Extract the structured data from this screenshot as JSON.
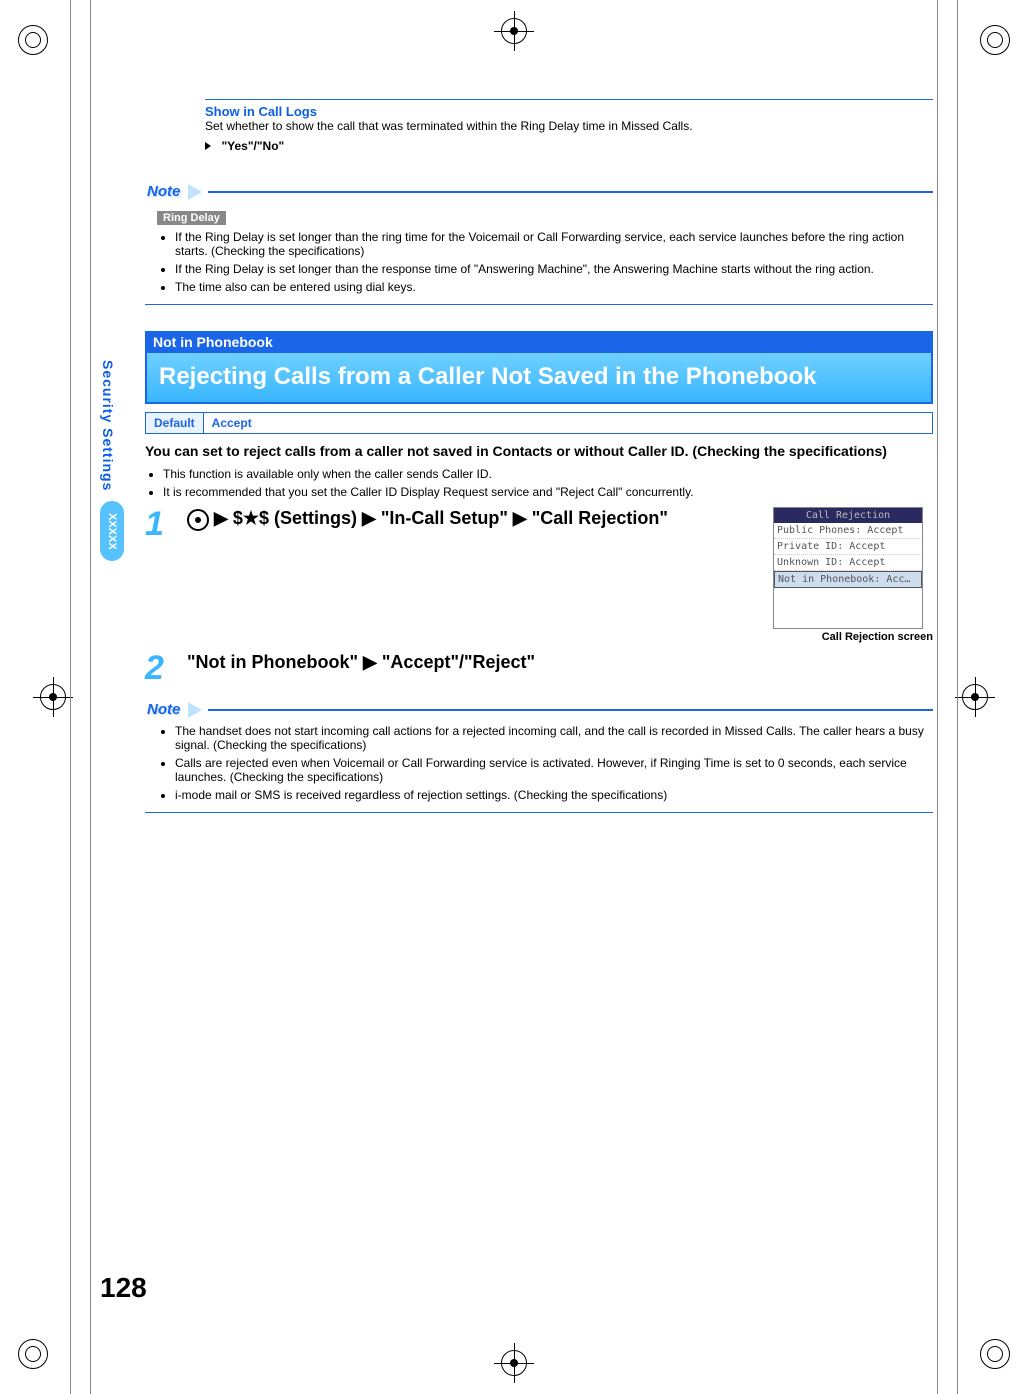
{
  "side": {
    "label": "Security Settings",
    "block": "XXXXX"
  },
  "show_in_call_logs": {
    "heading": "Show in Call Logs",
    "desc": "Set whether to show the call that was terminated within the Ring Delay time in Missed Calls.",
    "option": "\"Yes\"/\"No\""
  },
  "note1": {
    "label": "Note",
    "chip": "Ring Delay",
    "bullets": [
      "If the Ring Delay is set longer than the ring time for the Voicemail or Call Forwarding service, each service launches before the ring action starts. (Checking the specifications)",
      "If the Ring Delay is set longer than the response time of \"Answering Machine\", the Answering Machine starts without the ring action.",
      "The time also can be entered using dial keys."
    ]
  },
  "section": {
    "banner": "Not in Phonebook",
    "title": "Rejecting Calls from a Caller Not Saved in the Phonebook",
    "default_k": "Default",
    "default_v": "Accept",
    "intro": "You can set to reject calls from a caller not saved in Contacts or without Caller ID. (Checking the specifications)",
    "intro_bullets": [
      "This function is available only when the caller sends Caller ID.",
      "It is recommended that you set the Caller ID Display Request service and \"Reject Call\" concurrently."
    ]
  },
  "steps": {
    "s1_prefix_after_button": " ▶ $★$ (Settings) ▶ \"In-Call Setup\" ▶ \"Call Rejection\"",
    "s2": "\"Not in Phonebook\" ▶ \"Accept\"/\"Reject\""
  },
  "screenshot": {
    "title": "Call Rejection",
    "rows": [
      "Public Phones: Accept",
      "Private ID: Accept",
      "Unknown ID: Accept",
      "Not in Phonebook: Acc…"
    ],
    "caption": "Call Rejection screen"
  },
  "note2": {
    "label": "Note",
    "bullets": [
      "The handset does not start incoming call actions for a rejected incoming call, and the call is recorded in Missed Calls. The caller hears a busy signal. (Checking the specifications)",
      "Calls are rejected even when Voicemail or Call Forwarding service is activated. However, if Ringing Time is set to 0 seconds, each service launches. (Checking the specifications)",
      "i-mode mail or SMS is received regardless of rejection settings. (Checking the specifications)"
    ]
  },
  "page_number": "128"
}
